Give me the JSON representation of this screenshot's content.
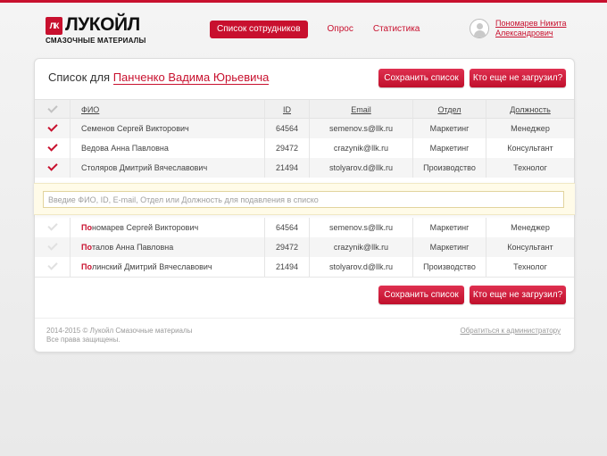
{
  "brand": {
    "mark": "ЛК",
    "name": "ЛУКОЙЛ",
    "sub": "СМАЗОЧНЫЕ МАТЕРИАЛЫ",
    "accent": "#c8102e"
  },
  "nav": {
    "items": [
      {
        "label": "Список сотрудников",
        "active": true
      },
      {
        "label": "Опрос",
        "active": false
      },
      {
        "label": "Статистика",
        "active": false
      }
    ]
  },
  "user": {
    "name": "Пономарев Никита Александрович",
    "avatar_icon": "user-avatar-icon"
  },
  "card": {
    "title_prefix": "Список для",
    "title_person": "Панченко Вадима Юрьевича",
    "save_label": "Сохранить список",
    "who_label": "Кто еще не загрузил?"
  },
  "table": {
    "columns": [
      "ФИО",
      "ID",
      "Email",
      "Отдел",
      "Должность"
    ],
    "selected": [
      {
        "name": "Семенов Сергей Викторович",
        "id": "64564",
        "email": "semenov.s@llk.ru",
        "dept": "Маркетинг",
        "role": "Менеджер"
      },
      {
        "name": "Ведова Анна Павловна",
        "id": "29472",
        "email": "crazynik@llk.ru",
        "dept": "Маркетинг",
        "role": "Консультант"
      },
      {
        "name": "Столяров Дмитрий Вячеславович",
        "id": "21494",
        "email": "stolyarov.d@llk.ru",
        "dept": "Производство",
        "role": "Технолог"
      }
    ],
    "results": [
      {
        "match": "По",
        "rest": "номарев Сергей Викторович",
        "id": "64564",
        "email": "semenov.s@llk.ru",
        "dept": "Маркетинг",
        "role": "Менеджер"
      },
      {
        "match": "По",
        "rest": "талов Анна Павловна",
        "id": "29472",
        "email": "crazynik@llk.ru",
        "dept": "Маркетинг",
        "role": "Консультант"
      },
      {
        "match": "По",
        "rest": "линский Дмитрий Вячеславович",
        "id": "21494",
        "email": "stolyarov.d@llk.ru",
        "dept": "Производство",
        "role": "Технолог"
      }
    ]
  },
  "search": {
    "value": "",
    "placeholder": "Введие ФИО, ID, E-mail, Отдел или Должность для подавления в списко"
  },
  "footer": {
    "copyright_line1": "2014-2015 © Лукойл Смазочные материалы",
    "copyright_line2": "Все права защищены.",
    "contact_link": "Обратиться к администратору"
  }
}
